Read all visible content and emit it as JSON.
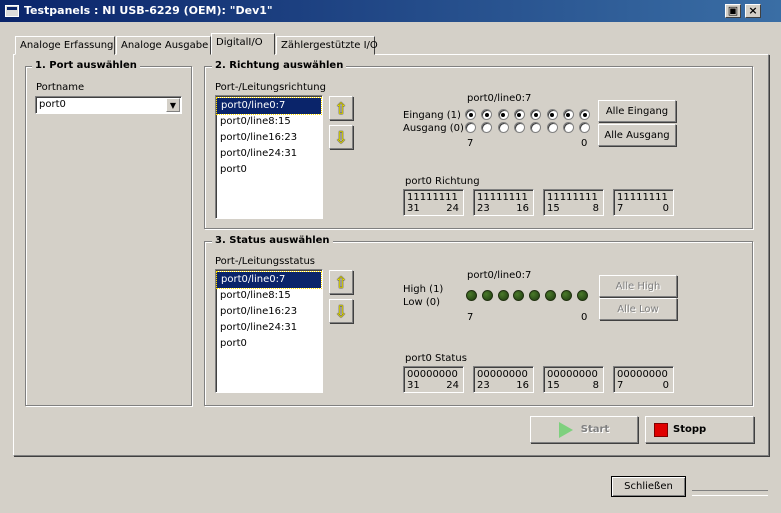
{
  "window": {
    "title": "Testpanels : NI USB-6229 (OEM): \"Dev1\""
  },
  "tabs": [
    "Analoge Erfassung",
    "Analoge Ausgabe",
    "DigitalI/O",
    "Zählergestützte I/O"
  ],
  "port_group": {
    "label": "1. Port auswählen",
    "portname_label": "Portname",
    "portname_value": "port0"
  },
  "direction_group": {
    "label": "2. Richtung auswählen",
    "list_label": "Port-/Leitungsrichtung",
    "items": [
      "port0/line0:7",
      "port0/line8:15",
      "port0/line16:23",
      "port0/line24:31",
      "port0"
    ],
    "selected_index": 0,
    "line_label": "port0/line0:7",
    "input_label": "Eingang (1)",
    "output_label": "Ausgang (0)",
    "bits_input": [
      1,
      1,
      1,
      1,
      1,
      1,
      1,
      1
    ],
    "range_high": "7",
    "range_low": "0",
    "all_input_button": "Alle Eingang",
    "all_output_button": "Alle Ausgang",
    "register_label": "port0 Richtung",
    "registers": [
      {
        "value": "11111111",
        "high": "31",
        "low": "24"
      },
      {
        "value": "11111111",
        "high": "23",
        "low": "16"
      },
      {
        "value": "11111111",
        "high": "15",
        "low": "8"
      },
      {
        "value": "11111111",
        "high": "7",
        "low": "0"
      }
    ]
  },
  "status_group": {
    "label": "3. Status auswählen",
    "list_label": "Port-/Leitungsstatus",
    "items": [
      "port0/line0:7",
      "port0/line8:15",
      "port0/line16:23",
      "port0/line24:31",
      "port0"
    ],
    "selected_index": 0,
    "line_label": "port0/line0:7",
    "high_label": "High (1)",
    "low_label": "Low (0)",
    "range_high": "7",
    "range_low": "0",
    "all_high_button": "Alle High",
    "all_low_button": "Alle Low",
    "register_label": "port0 Status",
    "registers": [
      {
        "value": "00000000",
        "high": "31",
        "low": "24"
      },
      {
        "value": "00000000",
        "high": "23",
        "low": "16"
      },
      {
        "value": "00000000",
        "high": "15",
        "low": "8"
      },
      {
        "value": "00000000",
        "high": "7",
        "low": "0"
      }
    ]
  },
  "start_button": "Start",
  "stop_button": "Stopp",
  "close_button": "Schließen",
  "colors": {
    "titlebar": "#0a246a",
    "selection": "#0a246a",
    "led_off": "#2f5a1a",
    "stop_square": "#e00000",
    "start_arrow": "#7ed07e"
  }
}
